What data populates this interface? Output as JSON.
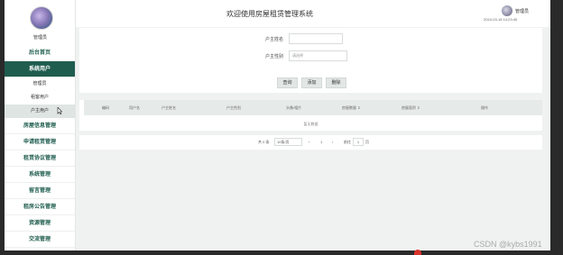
{
  "header": {
    "title": "欢迎使用房屋租赁管理系统",
    "user": "管理员",
    "time": "2024-03-18 14:23:45"
  },
  "sidebar": {
    "username": "管理员",
    "items": [
      {
        "label": "后台首页"
      },
      {
        "label": "系统用户"
      },
      {
        "label": "管理员"
      },
      {
        "label": "租客用户"
      },
      {
        "label": "户主用户"
      },
      {
        "label": "房屋信息管理"
      },
      {
        "label": "申请租赁管理"
      },
      {
        "label": "租赁协议管理"
      },
      {
        "label": "系统管理"
      },
      {
        "label": "留言管理"
      },
      {
        "label": "租房公告管理"
      },
      {
        "label": "资源管理"
      },
      {
        "label": "交流管理"
      }
    ]
  },
  "search": {
    "name_label": "户主姓名",
    "name_value": "",
    "gender_label": "户主性别",
    "gender_placeholder": "请选择",
    "query_label": "查询",
    "add_label": "添加",
    "delete_label": "删除"
  },
  "table": {
    "columns": [
      "编码",
      "用户名",
      "户主姓名",
      "户主性别",
      "头像/相片",
      "房屋数量 ⇕",
      "房屋面积 ⇕",
      "操作"
    ],
    "empty_text": "暂无数据"
  },
  "pagination": {
    "total": "共 0 条",
    "page_size": "10条/页",
    "prev": "‹",
    "page": "1",
    "next": "›",
    "goto": "前往",
    "goto_value": "1",
    "page_unit": "页"
  },
  "watermark": "CSDN @kybs1991",
  "colors": {
    "accent": "#1f5d4e",
    "sub_active": "#dfe5e3",
    "table_head": "#e6ebe9",
    "button": "#e2e7e5"
  },
  "icons": [
    "user-avatar-icon",
    "pointer-cursor-icon",
    "sort-icon"
  ]
}
